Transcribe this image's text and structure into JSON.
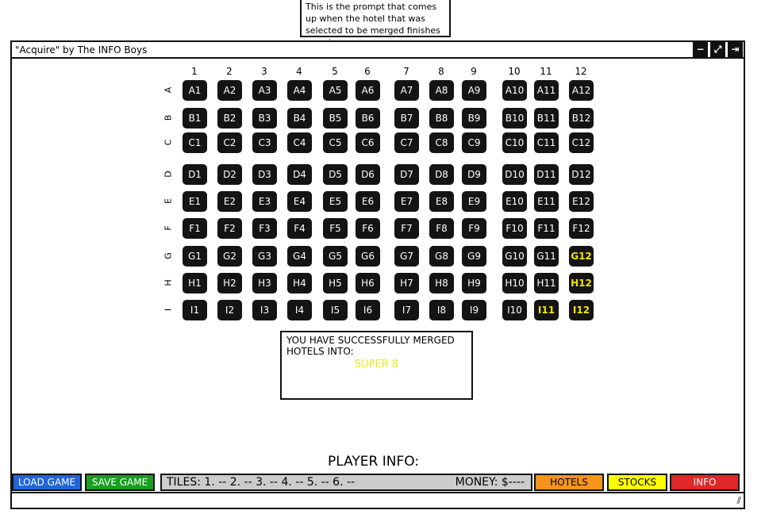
{
  "callout": {
    "text": "This is the prompt that comes up when the hotel that was selected to be merged finishes merging."
  },
  "window": {
    "title": "\"Acquire\" by The INFO Boys",
    "controls": {
      "minimize": "−",
      "maximize": "⤢",
      "close": "⇥"
    }
  },
  "board": {
    "columns": [
      "1",
      "2",
      "3",
      "4",
      "5",
      "6",
      "7",
      "8",
      "9",
      "10",
      "11",
      "12"
    ],
    "rows": [
      "A",
      "B",
      "C",
      "D",
      "E",
      "F",
      "G",
      "H",
      "I"
    ],
    "highlighted_tiles": [
      "G12",
      "H12",
      "I11",
      "I12"
    ],
    "highlight_color": "#f2e400"
  },
  "message": {
    "text": "YOU HAVE SUCCESSFULLY MERGED HOTELS INTO:",
    "hotel": "SUPER 8",
    "hotel_color": "#eaea20"
  },
  "player_info": {
    "title": "PLAYER INFO:",
    "tiles": "TILES: 1. --   2. --   3. --   4. --   5. --   6. --",
    "money": "MONEY: $----"
  },
  "buttons": {
    "load_game": "LOAD GAME",
    "save_game": "SAVE GAME",
    "hotels": "HOTELS",
    "stocks": "STOCKS",
    "info": "INFO"
  },
  "colors": {
    "load_game": "#1f66d8",
    "save_game": "#16a01e",
    "hotels": "#f7941d",
    "stocks": "#ffff00",
    "info": "#e02828"
  }
}
